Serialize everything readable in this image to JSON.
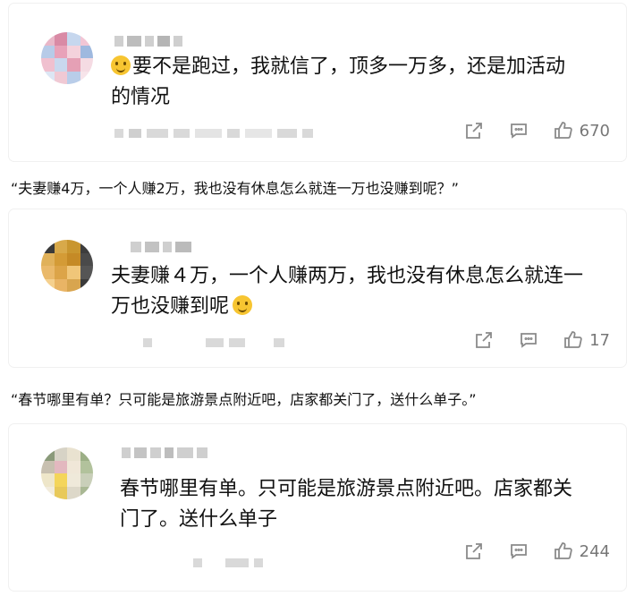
{
  "comments": [
    {
      "text_line1": "要不是跑过，我就信了，顶多一万多，还是加活动",
      "text_line2": "的情况",
      "like_count": "670",
      "emoji": "laughing-tears-emoji"
    },
    {
      "text_line1": "夫妻赚４万，一个人赚两万，我也没有休息怎么就连一",
      "text_line2": "万也没赚到呢",
      "like_count": "17",
      "emoji": "smile-emoji"
    },
    {
      "text_line1": "春节哪里有单。只可能是旅游景点附近吧。店家都关",
      "text_line2": "门了。送什么单子",
      "like_count": "244"
    }
  ],
  "quotes": [
    "“夫妻赚4万，一个人赚2万，我也没有休息怎么就连一万也没赚到呢？”",
    "“春节哪里有单？只可能是旅游景点附近吧，店家都关门了，送什么单子。”"
  ],
  "icons": {
    "share": "share-icon",
    "comment": "comment-icon",
    "like": "thumbs-up-icon"
  },
  "colors": {
    "action_gray": "#8a8a8a",
    "blur_gray": "#d9d9d9"
  }
}
